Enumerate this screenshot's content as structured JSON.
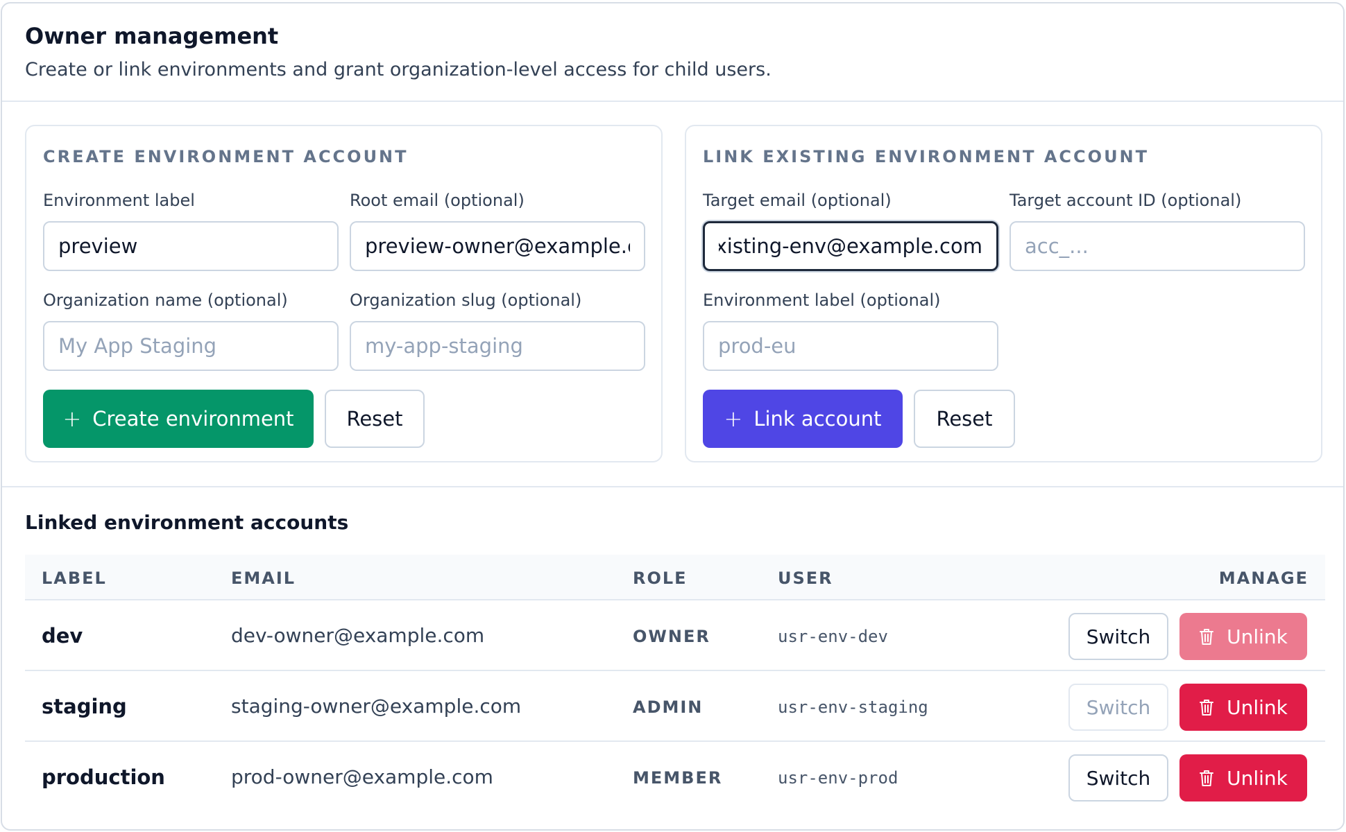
{
  "header": {
    "title": "Owner management",
    "subtitle": "Create or link environments and grant organization-level access for child users."
  },
  "create_panel": {
    "title": "CREATE ENVIRONMENT ACCOUNT",
    "env_label": {
      "label": "Environment label",
      "value": "preview",
      "placeholder": ""
    },
    "root_email": {
      "label": "Root email (optional)",
      "value": "preview-owner@example.com",
      "placeholder": ""
    },
    "org_name": {
      "label": "Organization name (optional)",
      "value": "",
      "placeholder": "My App Staging"
    },
    "org_slug": {
      "label": "Organization slug (optional)",
      "value": "",
      "placeholder": "my-app-staging"
    },
    "create_button": "Create environment",
    "reset_button": "Reset"
  },
  "link_panel": {
    "title": "LINK EXISTING ENVIRONMENT ACCOUNT",
    "target_email": {
      "label": "Target email (optional)",
      "value": "existing-env@example.com",
      "placeholder": ""
    },
    "target_account_id": {
      "label": "Target account ID (optional)",
      "value": "",
      "placeholder": "acc_..."
    },
    "env_label": {
      "label": "Environment label (optional)",
      "value": "",
      "placeholder": "prod-eu"
    },
    "link_button": "Link account",
    "reset_button": "Reset"
  },
  "linked": {
    "title": "Linked environment accounts",
    "columns": {
      "label": "LABEL",
      "email": "EMAIL",
      "role": "ROLE",
      "user": "USER",
      "manage": "MANAGE"
    },
    "rows": [
      {
        "label": "dev",
        "email": "dev-owner@example.com",
        "role": "OWNER",
        "user": "usr-env-dev",
        "switch": "Switch",
        "unlink": "Unlink"
      },
      {
        "label": "staging",
        "email": "staging-owner@example.com",
        "role": "ADMIN",
        "user": "usr-env-staging",
        "switch": "Switch",
        "unlink": "Unlink"
      },
      {
        "label": "production",
        "email": "prod-owner@example.com",
        "role": "MEMBER",
        "user": "usr-env-prod",
        "switch": "Switch",
        "unlink": "Unlink"
      }
    ]
  },
  "icons": {
    "plus": "plus-icon",
    "trash": "trash-icon"
  },
  "colors": {
    "create": "#059669",
    "link": "#4f46e5",
    "danger": "#e11d48",
    "danger_disabled": "#ec7a8f"
  }
}
